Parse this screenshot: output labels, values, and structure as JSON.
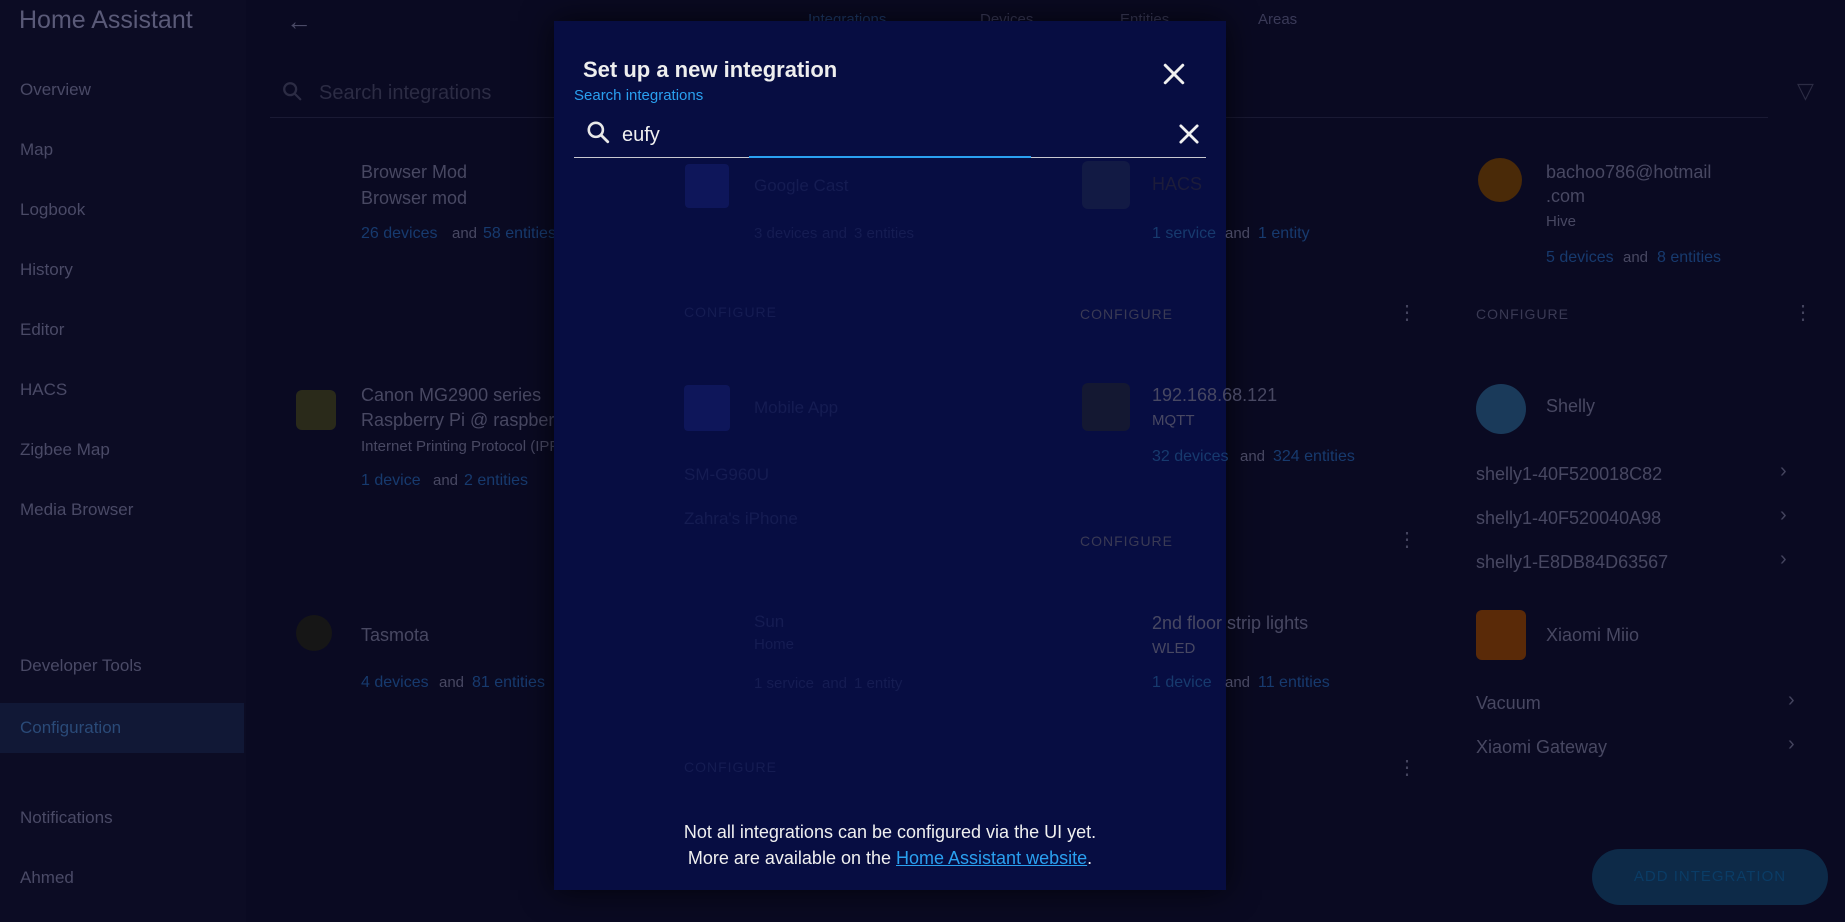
{
  "app": {
    "title": "Home Assistant"
  },
  "sidebar": {
    "items": [
      {
        "label": "Overview"
      },
      {
        "label": "Map"
      },
      {
        "label": "Logbook"
      },
      {
        "label": "History"
      },
      {
        "label": "Editor"
      },
      {
        "label": "HACS"
      },
      {
        "label": "Zigbee Map"
      },
      {
        "label": "Media Browser"
      },
      {
        "label": "Developer Tools"
      },
      {
        "label": "Configuration"
      },
      {
        "label": "Notifications"
      },
      {
        "label": "Ahmed"
      }
    ]
  },
  "topbar": {
    "tabs": [
      {
        "label": "Integrations"
      },
      {
        "label": "Devices"
      },
      {
        "label": "Entities"
      },
      {
        "label": "Areas"
      }
    ]
  },
  "background": {
    "search_placeholder": "Search integrations",
    "cards": {
      "browser_mod": {
        "name": "Browser Mod",
        "sub": "Browser mod",
        "devices": "26 devices",
        "and": "and",
        "entities": "58 entities"
      },
      "google_cast": {
        "name": "Google Cast",
        "devices": "3 devices",
        "and": "and",
        "entities": "3 entities"
      },
      "hacs": {
        "name": "HACS",
        "devices": "1 service",
        "and": "and",
        "entities": "1 entity"
      },
      "user_email": {
        "name": "bachoo786@hotmail",
        "name2": ".com",
        "sub": "Hive",
        "devices": "5 devices",
        "and": "and",
        "entities": "8 entities"
      },
      "canon": {
        "name": "Canon MG2900 series",
        "sub": "Raspberry Pi @ raspberrypi",
        "sub2": "Internet Printing Protocol (IPP)",
        "devices": "1 device",
        "and": "and",
        "entities": "2 entities"
      },
      "mobile_app": {
        "name": "Mobile App",
        "item1": "SM-G960U",
        "item2": "Zahra's iPhone"
      },
      "ip_device": {
        "name": "192.168.68.121",
        "sub": "MQTT",
        "devices": "32 devices",
        "and": "and",
        "entities": "324 entities"
      },
      "shelly": {
        "name": "Shelly",
        "item1": "shelly1-40F520018C82",
        "item2": "shelly1-40F520040A98",
        "item3": "shelly1-E8DB84D63567"
      },
      "tasmota": {
        "name": "Tasmota",
        "devices": "4 devices",
        "and": "and",
        "entities": "81 entities"
      },
      "sun": {
        "name": "Sun",
        "sub": "Home",
        "devices": "1 service",
        "and": "and",
        "entities": "1 entity"
      },
      "led": {
        "name": "2nd floor strip lights",
        "sub": "WLED",
        "devices": "1 device",
        "and": "and",
        "entities": "11 entities"
      },
      "xiaomi": {
        "name": "Xiaomi Miio",
        "item1": "Vacuum",
        "item2": "Xiaomi Gateway"
      }
    },
    "configure_label": "CONFIGURE",
    "fab_label": "ADD INTEGRATION"
  },
  "dialog": {
    "title": "Set up a new integration",
    "search_label": "Search integrations",
    "search_value": "eufy",
    "footer_line1": "Not all integrations can be configured via the UI yet.",
    "footer_line2_prefix": "More are available on the",
    "footer_link": "Home Assistant website",
    "footer_line2_suffix": "."
  },
  "colors": {
    "accent": "#2aa0f0",
    "dialog_bg": "#070d42",
    "page_bg": "#0a0a22"
  }
}
